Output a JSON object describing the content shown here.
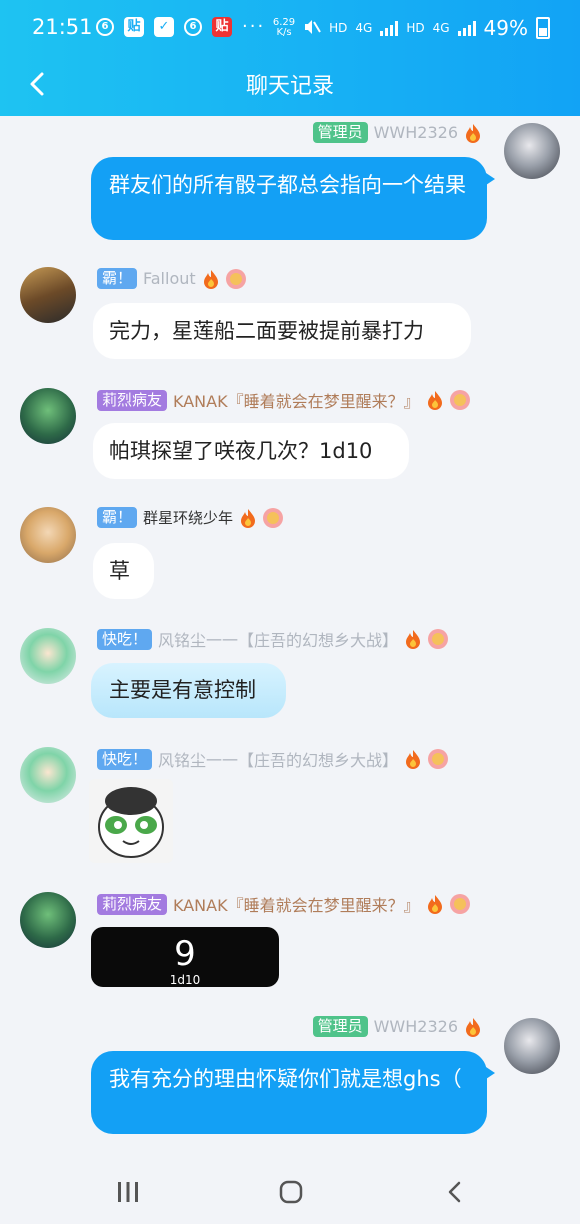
{
  "status_bar": {
    "time": "21:51",
    "left_icons": [
      "baidu-icon",
      "tieba-icon",
      "check-icon",
      "baidu-icon",
      "tieba-red-icon"
    ],
    "more": "···",
    "speed_value": "6.29",
    "speed_unit": "K/s",
    "hd1": "HD",
    "net1": "4G",
    "hd2": "HD",
    "net2": "4G",
    "battery": "49%"
  },
  "header": {
    "title": "聊天记录",
    "accent_color": "#13a0f5"
  },
  "messages": [
    {
      "side": "right",
      "badge": "管理员",
      "name": "WWH2326",
      "text": "群友们的所有骰子都总会指向一个结果"
    },
    {
      "side": "left",
      "badge": "霸！",
      "name": "Fallout",
      "text": "完力，星莲船二面要被提前暴打力"
    },
    {
      "side": "left",
      "badge": "莉烈病友",
      "name": "KANAK『睡着就会在梦里醒来？』",
      "text": "帕琪探望了咲夜几次？1d10"
    },
    {
      "side": "left",
      "badge": "霸！",
      "name": "群星环绕少年",
      "text": "草"
    },
    {
      "side": "left",
      "badge": "快吃！",
      "name": "风铭尘一一【庄吾的幻想乡大战】",
      "text": "主要是有意控制"
    },
    {
      "side": "left",
      "badge": "快吃！",
      "name": "风铭尘一一【庄吾的幻想乡大战】",
      "sticker": "panda-face-sticker"
    },
    {
      "side": "left",
      "badge": "莉烈病友",
      "name": "KANAK『睡着就会在梦里醒来？』",
      "dice_value": "9",
      "dice_label": "1d10"
    },
    {
      "side": "right",
      "badge": "管理员",
      "name": "WWH2326",
      "text": "我有充分的理由怀疑你们就是想ghs（"
    }
  ],
  "bottom_nav": {
    "recent": "recent-apps-icon",
    "home": "home-icon",
    "back": "back-icon"
  }
}
